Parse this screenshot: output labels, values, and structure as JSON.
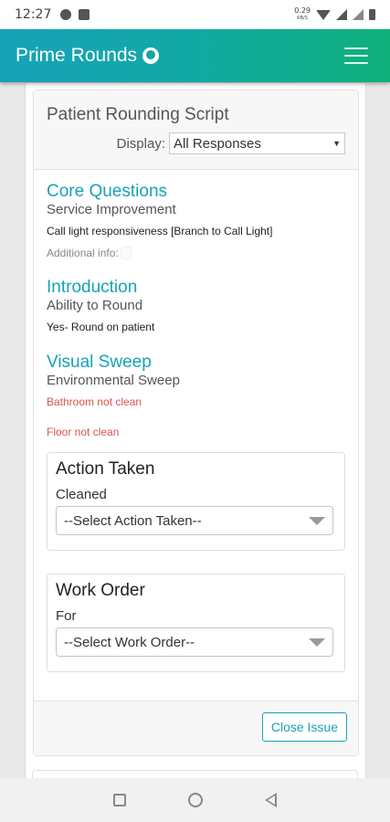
{
  "status_bar": {
    "time": "12:27",
    "net_speed_value": "0.29",
    "net_speed_unit": "KB/S",
    "icons": [
      "notification-icon",
      "image-icon",
      "wifi-icon",
      "signal-icon",
      "signal-x-icon",
      "battery-icon"
    ]
  },
  "navbar": {
    "brand": "Prime Rounds",
    "brand_color": "#17a2b8",
    "accent_color": "#0fb07a"
  },
  "card": {
    "title": "Patient Rounding Script",
    "display_label": "Display:",
    "display_selected": "All Responses"
  },
  "sections": [
    {
      "title": "Core Questions",
      "subtitle": "Service Improvement",
      "answer": "Call light responsiveness [Branch to Call Light]",
      "additional_info_label": "Additional info:"
    },
    {
      "title": "Introduction",
      "subtitle": "Ability to Round",
      "answer": "Yes- Round on patient"
    },
    {
      "title": "Visual Sweep",
      "subtitle": "Environmental Sweep",
      "issues": [
        "Bathroom not clean",
        "Floor not clean"
      ],
      "issue_color": "#d9534f"
    }
  ],
  "action_panel": {
    "title": "Action Taken",
    "label": "Cleaned",
    "select_value": "--Select Action Taken--"
  },
  "work_order_panel": {
    "title": "Work Order",
    "label": "For",
    "select_value": "--Select Work Order--"
  },
  "footer": {
    "close_label": "Close Issue"
  }
}
